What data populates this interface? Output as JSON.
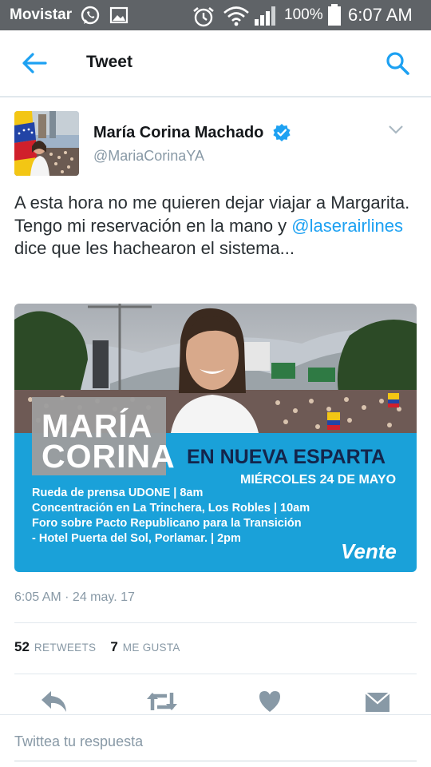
{
  "status_bar": {
    "carrier": "Movistar",
    "battery_percent": "100%",
    "time": "6:07 AM",
    "icons": [
      "whatsapp-icon",
      "gallery-icon",
      "alarm-icon",
      "wifi-icon",
      "signal-icon",
      "battery-icon"
    ]
  },
  "header": {
    "title": "Tweet",
    "icons": [
      "back-arrow-icon",
      "search-icon"
    ]
  },
  "tweet": {
    "author_name": "María Corina Machado",
    "handle": "@MariaCorinaYA",
    "verified": true,
    "text_before": "A esta hora no me quieren dejar viajar a Margarita. Tengo mi reservación en la mano y ",
    "mention": "@laserairlines",
    "text_after": " dice que les hachearon el sistema...",
    "timestamp": "6:05 AM · 24 may. 17",
    "retweets_count": "52",
    "retweets_label": "RETWEETS",
    "likes_count": "7",
    "likes_label": "ME GUSTA"
  },
  "media": {
    "name_line1": "MARÍA",
    "name_line2": "CORINA",
    "headline": "EN NUEVA ESPARTA",
    "date": "MIÉRCOLES 24 DE MAYO",
    "lines": [
      "Rueda de prensa UDONE | 8am",
      "Concentración en La Trinchera, Los Robles | 10am",
      "Foro sobre Pacto Republicano para la Transición",
      "- Hotel Puerta del Sol, Porlamar. | 2pm"
    ],
    "brand": "Vente"
  },
  "actions": [
    "reply-icon",
    "retweet-icon",
    "like-icon",
    "direct-message-icon"
  ],
  "reply": {
    "placeholder": "Twittea tu respuesta"
  },
  "colors": {
    "accent": "#1da1f2",
    "status_bar": "#5f6367",
    "media_band": "#1aa1d9",
    "headline": "#13254b",
    "muted": "#8899a6"
  }
}
